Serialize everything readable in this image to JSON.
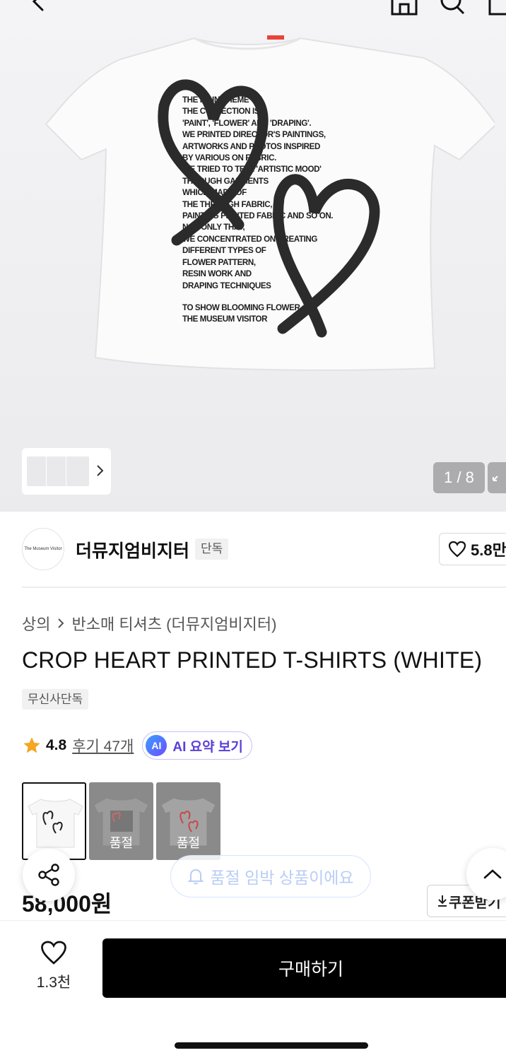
{
  "gallery": {
    "counter": "1 / 8",
    "print_lines": [
      "THE MAIN THEME OF",
      "THE COLLECTION IS",
      "'PAINT', 'FLOWER' AND 'DRAPING'.",
      "WE PRINTED DIRECTOR'S PAINTINGS,",
      "ARTWORKS AND PHOTOS INSPIRED",
      "BY VARIOUS ON FABRIC.",
      "WE TRIED TO TELL 'ARTISTIC MOOD'",
      "THROUGH GARMENTS",
      "WHICH MADE OF",
      "THE THROUGH FABRIC,",
      "PAINTING PRINTED FABRIC AND SO ON.",
      "NOT ONLY THAT,",
      "WE CONCENTRATED ON CREATING",
      "DIFFERENT TYPES OF",
      "FLOWER PATTERN,",
      "RESIN WORK AND",
      "DRAPING TECHNIQUES"
    ],
    "print_lines_2": [
      "TO SHOW BLOOMING FLOWER",
      "THE MUSEUM VISITOR"
    ]
  },
  "brand": {
    "logo_text": "The Museum Visitor",
    "name": "더뮤지엄비지터",
    "badge": "단독",
    "like_count": "5.8만"
  },
  "breadcrumb": {
    "category": "상의",
    "subcategory": "반소매 티셔츠 (더뮤지엄비지터)"
  },
  "product": {
    "title": "CROP HEART PRINTED T-SHIRTS (WHITE)",
    "exclusive_badge": "무신사단독",
    "rating": "4.8",
    "review_link": "후기 47개",
    "ai_badge": "AI",
    "ai_summary_label": "AI 요약 보기",
    "price": "58,000원"
  },
  "color_options": [
    {
      "soldout": ""
    },
    {
      "soldout": "품절"
    },
    {
      "soldout": "품절"
    }
  ],
  "notice": "품절 임박 상품이에요",
  "coupon_label": "쿠폰받기",
  "bottom": {
    "wish_count": "1.3천",
    "buy_label": "구매하기"
  },
  "colors": {
    "accent": "#000000",
    "ai_purple": "#5a3fd6",
    "star": "#f5a623"
  }
}
